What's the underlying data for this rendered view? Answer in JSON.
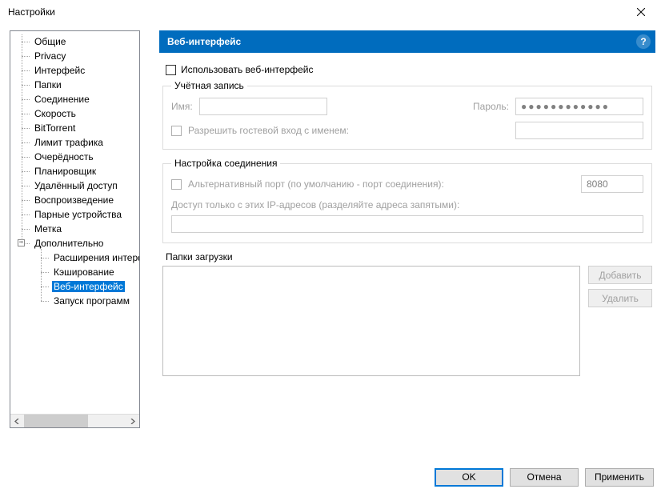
{
  "window": {
    "title": "Настройки"
  },
  "tree": {
    "items": [
      {
        "label": "Общие",
        "level": 1
      },
      {
        "label": "Privacy",
        "level": 1
      },
      {
        "label": "Интерфейс",
        "level": 1
      },
      {
        "label": "Папки",
        "level": 1
      },
      {
        "label": "Соединение",
        "level": 1
      },
      {
        "label": "Скорость",
        "level": 1
      },
      {
        "label": "BitTorrent",
        "level": 1
      },
      {
        "label": "Лимит трафика",
        "level": 1
      },
      {
        "label": "Очерёдность",
        "level": 1
      },
      {
        "label": "Планировщик",
        "level": 1
      },
      {
        "label": "Удалённый доступ",
        "level": 1
      },
      {
        "label": "Воспроизведение",
        "level": 1
      },
      {
        "label": "Парные устройства",
        "level": 1
      },
      {
        "label": "Метка",
        "level": 1
      },
      {
        "label": "Дополнительно",
        "level": 1,
        "expandable": true
      },
      {
        "label": "Расширения интерфейса",
        "level": 2
      },
      {
        "label": "Кэширование",
        "level": 2
      },
      {
        "label": "Веб-интерфейс",
        "level": 2,
        "selected": true
      },
      {
        "label": "Запуск программ",
        "level": 2
      }
    ]
  },
  "header": {
    "title": "Веб-интерфейс",
    "help_tooltip": "?"
  },
  "form": {
    "enable_label": "Использовать веб-интерфейс",
    "account_group": "Учётная запись",
    "name_label": "Имя:",
    "name_value": "",
    "password_label": "Пароль:",
    "password_value": "●●●●●●●●●●●●",
    "guest_label": "Разрешить гостевой вход с именем:",
    "guest_value": "",
    "conn_group": "Настройка соединения",
    "alt_port_label": "Альтернативный порт (по умолчанию - порт соединения):",
    "alt_port_value": "8080",
    "ip_label": "Доступ только с этих IP-адресов (разделяйте адреса запятыми):",
    "ip_value": "",
    "dl_label": "Папки загрузки",
    "add_btn": "Добавить",
    "del_btn": "Удалить"
  },
  "footer": {
    "ok": "OK",
    "cancel": "Отмена",
    "apply": "Применить"
  }
}
